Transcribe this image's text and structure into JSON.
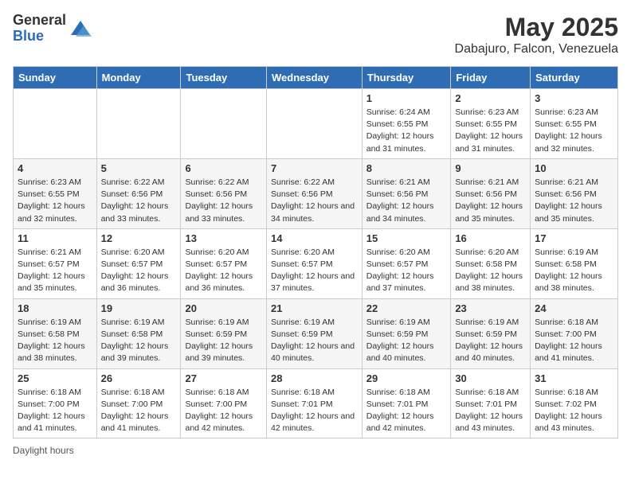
{
  "logo": {
    "general": "General",
    "blue": "Blue"
  },
  "title": "May 2025",
  "subtitle": "Dabajuro, Falcon, Venezuela",
  "days_of_week": [
    "Sunday",
    "Monday",
    "Tuesday",
    "Wednesday",
    "Thursday",
    "Friday",
    "Saturday"
  ],
  "footer_label": "Daylight hours",
  "weeks": [
    [
      {
        "day": "",
        "info": ""
      },
      {
        "day": "",
        "info": ""
      },
      {
        "day": "",
        "info": ""
      },
      {
        "day": "",
        "info": ""
      },
      {
        "day": "1",
        "info": "Sunrise: 6:24 AM\nSunset: 6:55 PM\nDaylight: 12 hours and 31 minutes."
      },
      {
        "day": "2",
        "info": "Sunrise: 6:23 AM\nSunset: 6:55 PM\nDaylight: 12 hours and 31 minutes."
      },
      {
        "day": "3",
        "info": "Sunrise: 6:23 AM\nSunset: 6:55 PM\nDaylight: 12 hours and 32 minutes."
      }
    ],
    [
      {
        "day": "4",
        "info": "Sunrise: 6:23 AM\nSunset: 6:55 PM\nDaylight: 12 hours and 32 minutes."
      },
      {
        "day": "5",
        "info": "Sunrise: 6:22 AM\nSunset: 6:56 PM\nDaylight: 12 hours and 33 minutes."
      },
      {
        "day": "6",
        "info": "Sunrise: 6:22 AM\nSunset: 6:56 PM\nDaylight: 12 hours and 33 minutes."
      },
      {
        "day": "7",
        "info": "Sunrise: 6:22 AM\nSunset: 6:56 PM\nDaylight: 12 hours and 34 minutes."
      },
      {
        "day": "8",
        "info": "Sunrise: 6:21 AM\nSunset: 6:56 PM\nDaylight: 12 hours and 34 minutes."
      },
      {
        "day": "9",
        "info": "Sunrise: 6:21 AM\nSunset: 6:56 PM\nDaylight: 12 hours and 35 minutes."
      },
      {
        "day": "10",
        "info": "Sunrise: 6:21 AM\nSunset: 6:56 PM\nDaylight: 12 hours and 35 minutes."
      }
    ],
    [
      {
        "day": "11",
        "info": "Sunrise: 6:21 AM\nSunset: 6:57 PM\nDaylight: 12 hours and 35 minutes."
      },
      {
        "day": "12",
        "info": "Sunrise: 6:20 AM\nSunset: 6:57 PM\nDaylight: 12 hours and 36 minutes."
      },
      {
        "day": "13",
        "info": "Sunrise: 6:20 AM\nSunset: 6:57 PM\nDaylight: 12 hours and 36 minutes."
      },
      {
        "day": "14",
        "info": "Sunrise: 6:20 AM\nSunset: 6:57 PM\nDaylight: 12 hours and 37 minutes."
      },
      {
        "day": "15",
        "info": "Sunrise: 6:20 AM\nSunset: 6:57 PM\nDaylight: 12 hours and 37 minutes."
      },
      {
        "day": "16",
        "info": "Sunrise: 6:20 AM\nSunset: 6:58 PM\nDaylight: 12 hours and 38 minutes."
      },
      {
        "day": "17",
        "info": "Sunrise: 6:19 AM\nSunset: 6:58 PM\nDaylight: 12 hours and 38 minutes."
      }
    ],
    [
      {
        "day": "18",
        "info": "Sunrise: 6:19 AM\nSunset: 6:58 PM\nDaylight: 12 hours and 38 minutes."
      },
      {
        "day": "19",
        "info": "Sunrise: 6:19 AM\nSunset: 6:58 PM\nDaylight: 12 hours and 39 minutes."
      },
      {
        "day": "20",
        "info": "Sunrise: 6:19 AM\nSunset: 6:59 PM\nDaylight: 12 hours and 39 minutes."
      },
      {
        "day": "21",
        "info": "Sunrise: 6:19 AM\nSunset: 6:59 PM\nDaylight: 12 hours and 40 minutes."
      },
      {
        "day": "22",
        "info": "Sunrise: 6:19 AM\nSunset: 6:59 PM\nDaylight: 12 hours and 40 minutes."
      },
      {
        "day": "23",
        "info": "Sunrise: 6:19 AM\nSunset: 6:59 PM\nDaylight: 12 hours and 40 minutes."
      },
      {
        "day": "24",
        "info": "Sunrise: 6:18 AM\nSunset: 7:00 PM\nDaylight: 12 hours and 41 minutes."
      }
    ],
    [
      {
        "day": "25",
        "info": "Sunrise: 6:18 AM\nSunset: 7:00 PM\nDaylight: 12 hours and 41 minutes."
      },
      {
        "day": "26",
        "info": "Sunrise: 6:18 AM\nSunset: 7:00 PM\nDaylight: 12 hours and 41 minutes."
      },
      {
        "day": "27",
        "info": "Sunrise: 6:18 AM\nSunset: 7:00 PM\nDaylight: 12 hours and 42 minutes."
      },
      {
        "day": "28",
        "info": "Sunrise: 6:18 AM\nSunset: 7:01 PM\nDaylight: 12 hours and 42 minutes."
      },
      {
        "day": "29",
        "info": "Sunrise: 6:18 AM\nSunset: 7:01 PM\nDaylight: 12 hours and 42 minutes."
      },
      {
        "day": "30",
        "info": "Sunrise: 6:18 AM\nSunset: 7:01 PM\nDaylight: 12 hours and 43 minutes."
      },
      {
        "day": "31",
        "info": "Sunrise: 6:18 AM\nSunset: 7:02 PM\nDaylight: 12 hours and 43 minutes."
      }
    ]
  ]
}
